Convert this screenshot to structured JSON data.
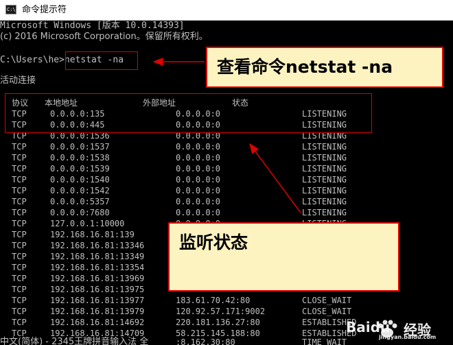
{
  "window": {
    "title": "命令提示符",
    "icon": "cmd-icon"
  },
  "header_lines": [
    "Microsoft Windows [版本 10.0.14393]",
    "(c) 2016 Microsoft Corporation。保留所有权利。"
  ],
  "prompt": {
    "path": "C:\\Users\\he>",
    "command": "netstat -na"
  },
  "section_title": "活动连接",
  "columns": [
    "协议",
    "本地地址",
    "外部地址",
    "状态"
  ],
  "rows": [
    [
      "TCP",
      "0.0.0.0:135",
      "0.0.0.0:0",
      "LISTENING"
    ],
    [
      "TCP",
      "0.0.0.0:445",
      "0.0.0.0:0",
      "LISTENING"
    ],
    [
      "TCP",
      "0.0.0.0:1536",
      "0.0.0.0:0",
      "LISTENING"
    ],
    [
      "TCP",
      "0.0.0.0:1537",
      "0.0.0.0:0",
      "LISTENING"
    ],
    [
      "TCP",
      "0.0.0.0:1538",
      "0.0.0.0:0",
      "LISTENING"
    ],
    [
      "TCP",
      "0.0.0.0:1539",
      "0.0.0.0:0",
      "LISTENING"
    ],
    [
      "TCP",
      "0.0.0.0:1540",
      "0.0.0.0:0",
      "LISTENING"
    ],
    [
      "TCP",
      "0.0.0.0:1542",
      "0.0.0.0:0",
      "LISTENING"
    ],
    [
      "TCP",
      "0.0.0.0:5357",
      "0.0.0.0:0",
      "LISTENING"
    ],
    [
      "TCP",
      "0.0.0.0:7680",
      "0.0.0.0:0",
      "LISTENING"
    ],
    [
      "TCP",
      "127.0.0.1:10000",
      "0.0.0.0:0",
      "LISTENING"
    ],
    [
      "TCP",
      "192.168.16.81:139",
      "0.0.0.0:0",
      "LISTENING"
    ],
    [
      "TCP",
      "192.168.16.81:13346",
      "",
      ""
    ],
    [
      "TCP",
      "192.168.16.81:13349",
      "",
      ""
    ],
    [
      "TCP",
      "192.168.16.81:13354",
      "",
      ""
    ],
    [
      "TCP",
      "192.168.16.81:13969",
      "",
      ""
    ],
    [
      "TCP",
      "192.168.16.81:13975",
      "",
      ""
    ],
    [
      "TCP",
      "192.168.16.81:13977",
      "183.61.70.42:80",
      "CLOSE_WAIT"
    ],
    [
      "TCP",
      "192.168.16.81:13979",
      "120.92.57.171:9002",
      "CLOSE_WAIT"
    ],
    [
      "TCP",
      "192.168.16.81:14692",
      "220.181.136.27:80",
      "ESTABLISHED"
    ],
    [
      "TCP",
      "192.168.16.81:14709",
      "58.215.145.188:80",
      "ESTABLISHED"
    ]
  ],
  "ime_bar": {
    "left": "中文(简体) - 2345王牌拼音输入法 全",
    "right": ":8.162.30:80",
    "status": "TIME_WAIT"
  },
  "annotations": {
    "command_callout": "查看命令netstat -na",
    "status_callout": "监听状态",
    "box_color": "#e00000",
    "callout_bg": "#fdf3c1"
  },
  "watermark": {
    "brand": "Baidu",
    "suffix": "经验",
    "url": "jingyan.baidu.com"
  }
}
